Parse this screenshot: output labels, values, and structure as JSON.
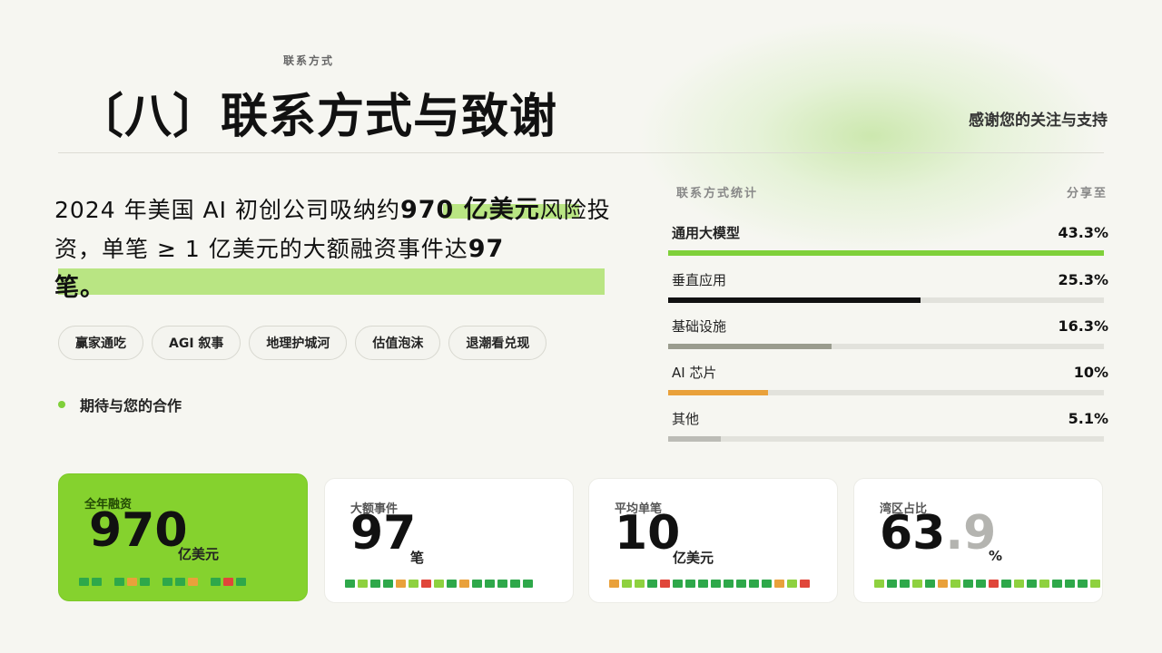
{
  "header": {
    "eyebrow": "联系方式",
    "title": "〔八〕联系方式与致谢",
    "thanks": "感谢您的关注与支持"
  },
  "headline": {
    "part1": "2024 年美国 AI 初创公司吸纳约",
    "bold1": "970 亿美元",
    "part2": "风险投资，单笔 ≥ 1 亿美元的大额融资事件达",
    "bold2": "97",
    "part3": "笔。"
  },
  "tags": [
    "赢家通吃",
    "AGI 叙事",
    "地理护城河",
    "估值泡沫",
    "退潮看兑现"
  ],
  "bullet": "期待与您的合作",
  "stats": {
    "title": "联系方式统计",
    "share": "分享至",
    "rows": [
      {
        "label": "通用大模型",
        "value": "43.3%",
        "fill": 1.0,
        "color": "#7fd03a"
      },
      {
        "label": "垂直应用",
        "value": "25.3%",
        "fill": 0.58,
        "color": "#111111"
      },
      {
        "label": "基础设施",
        "value": "16.3%",
        "fill": 0.375,
        "color": "#9a9c8e"
      },
      {
        "label": "AI 芯片",
        "value": "10%",
        "fill": 0.23,
        "color": "#e9a13b"
      },
      {
        "label": "其他",
        "value": "5.1%",
        "fill": 0.12,
        "color": "#bcbcb6"
      }
    ]
  },
  "cards": [
    {
      "label": "全年融资",
      "value": "970",
      "unit": "亿美元"
    },
    {
      "label": "大额事件",
      "value": "97",
      "unit": "笔"
    },
    {
      "label": "平均单笔",
      "value": "10",
      "unit": "亿美元"
    },
    {
      "label": "湾区占比",
      "value": "63",
      "decimal": ".9",
      "unit": "%"
    }
  ],
  "colors": {
    "accent_green": "#85d22e",
    "highlight": "#b9e583",
    "block_green": "#2ea84a",
    "block_lime": "#8ed13f",
    "block_orange": "#e9a13b",
    "block_red": "#e0463a"
  }
}
